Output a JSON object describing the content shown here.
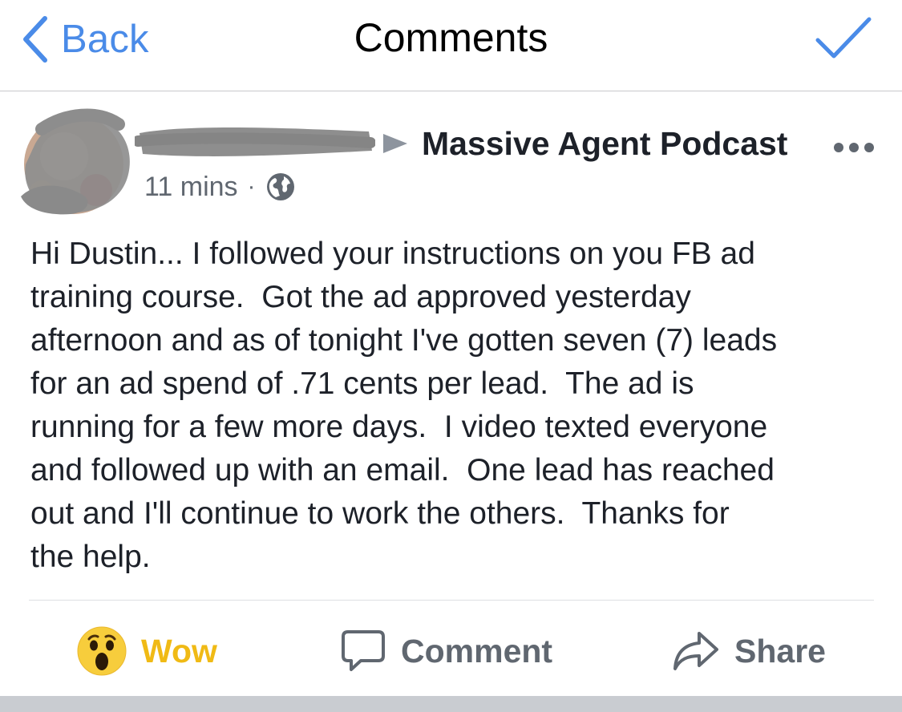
{
  "navbar": {
    "back_label": "Back",
    "title": "Comments",
    "back_icon": "chevron-left-icon",
    "done_icon": "checkmark-icon",
    "accent_color": "#4a8be8"
  },
  "post": {
    "page_name": "Massive Agent Podcast",
    "time": "11 mins",
    "separator": "·",
    "audience_icon": "globe-icon",
    "more_icon": "more-dots-icon",
    "text_lines": [
      "Hi Dustin... I followed your instructions on you FB ad",
      "training course.  Got the ad approved yesterday",
      "afternoon and as of tonight I've gotten seven (7) leads",
      "for an ad spend of .71 cents per lead.  The ad is",
      "running for a few more days.  I video texted everyone",
      "and followed up with an email.  One lead has reached",
      "out and I'll continue to work the others.  Thanks for",
      "the help."
    ]
  },
  "actions": {
    "reaction_label": "Wow",
    "reaction_icon": "wow-emoji-icon",
    "reaction_color": "#f0ba15",
    "comment_label": "Comment",
    "comment_icon": "speech-bubble-icon",
    "share_label": "Share",
    "share_icon": "share-arrow-icon"
  }
}
